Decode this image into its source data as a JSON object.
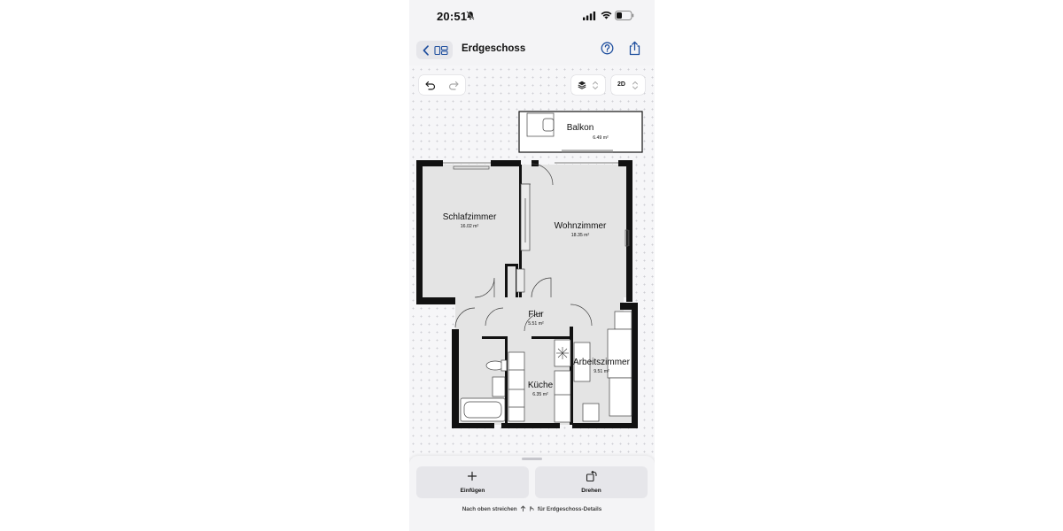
{
  "status": {
    "time": "20:51"
  },
  "nav": {
    "title": "Erdgeschoss"
  },
  "toolbar": {
    "view_mode": "2D"
  },
  "rooms": [
    {
      "name": "Balkon",
      "area": "6.49 m²"
    },
    {
      "name": "Schlafzimmer",
      "area": "16.02 m²"
    },
    {
      "name": "Wohnzimmer",
      "area": "18.35 m²"
    },
    {
      "name": "Flur",
      "area": "5.51 m²"
    },
    {
      "name": "Arbeitszimmer",
      "area": "9.51 m²"
    },
    {
      "name": "Küche",
      "area": "6.35 m²"
    }
  ],
  "sheet": {
    "insert_label": "Einfügen",
    "rotate_label": "Drehen",
    "hint_prefix": "Nach oben streichen",
    "hint_suffix": "für Erdgeschoss-Details"
  }
}
